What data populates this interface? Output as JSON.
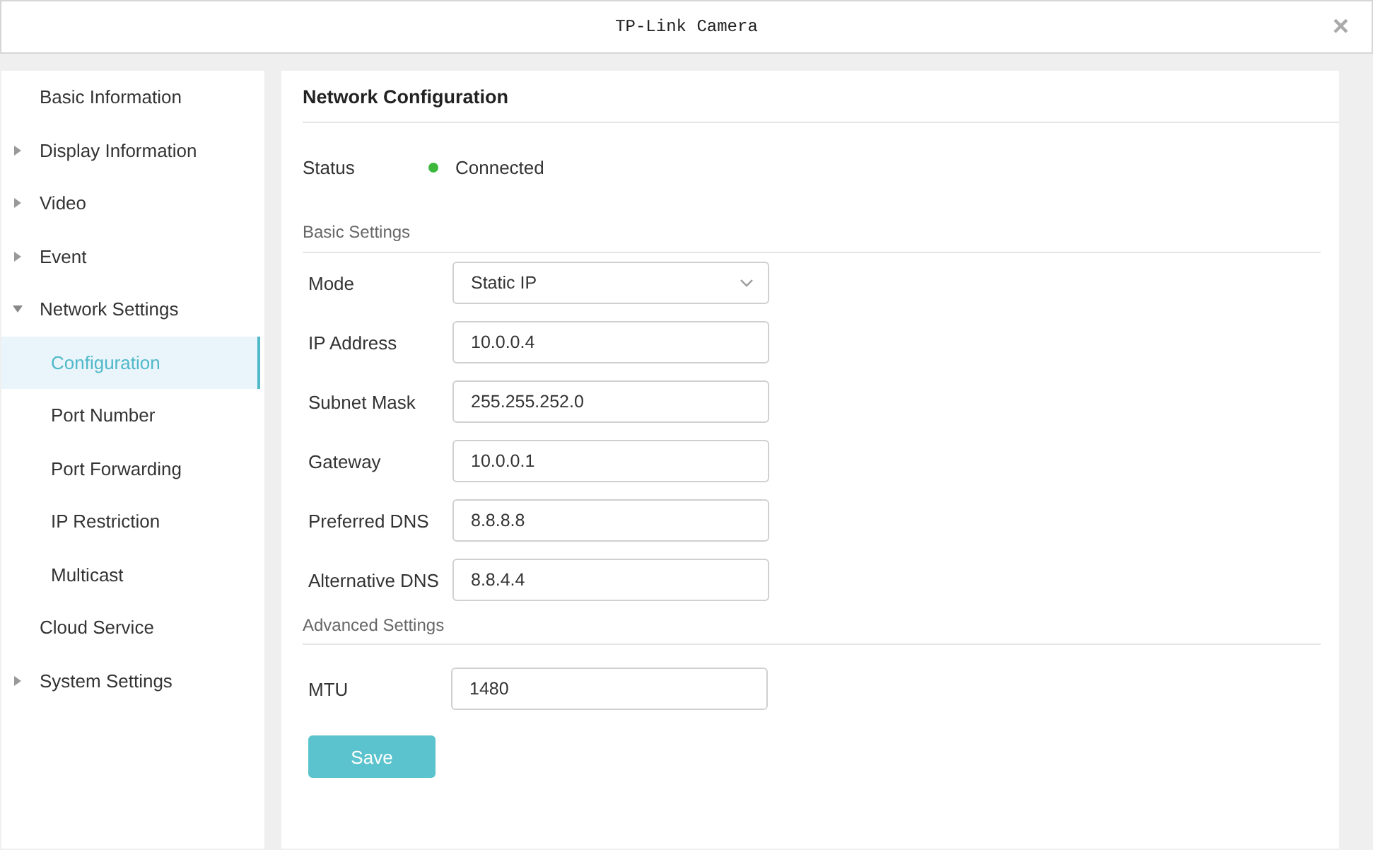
{
  "window": {
    "title": "TP-Link Camera",
    "close_icon": "×"
  },
  "sidebar": {
    "items": [
      {
        "label": "Basic Information",
        "selected": false
      },
      {
        "label": "Display Information",
        "selected": false,
        "expanded": false
      },
      {
        "label": "Video",
        "selected": false,
        "expanded": false
      },
      {
        "label": "Event",
        "selected": false,
        "expanded": false
      },
      {
        "label": "Network Settings",
        "selected": false,
        "expanded": true,
        "children": [
          {
            "label": "Configuration",
            "selected": true
          },
          {
            "label": "Port Number",
            "selected": false
          },
          {
            "label": "Port Forwarding",
            "selected": false
          },
          {
            "label": "IP Restriction",
            "selected": false
          },
          {
            "label": "Multicast",
            "selected": false
          }
        ]
      },
      {
        "label": "Cloud Service",
        "selected": false
      },
      {
        "label": "System Settings",
        "selected": false,
        "expanded": false
      }
    ]
  },
  "panel": {
    "title": "Network Configuration",
    "status": {
      "label": "Status",
      "value": "Connected",
      "color": "#3db83d"
    },
    "sections": [
      {
        "title": "Basic Settings",
        "fields": [
          {
            "kind": "select",
            "label": "Mode",
            "value": "Static IP"
          },
          {
            "kind": "text",
            "label": "IP Address",
            "value": "10.0.0.4"
          },
          {
            "kind": "text",
            "label": "Subnet Mask",
            "value": "255.255.252.0"
          },
          {
            "kind": "text",
            "label": "Gateway",
            "value": "10.0.0.1"
          },
          {
            "kind": "text",
            "label": "Preferred DNS",
            "value": "8.8.8.8"
          },
          {
            "kind": "text",
            "label": "Alternative DNS",
            "value": "8.8.4.4"
          }
        ]
      },
      {
        "title": "Advanced Settings",
        "fields": [
          {
            "kind": "text",
            "label": "MTU",
            "value": "1480"
          }
        ]
      }
    ],
    "save_button": "Save"
  }
}
